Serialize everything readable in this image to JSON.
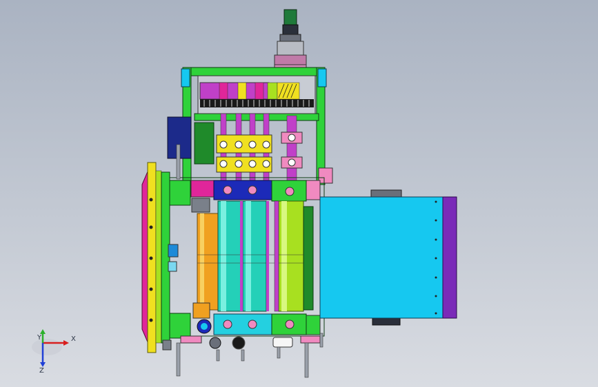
{
  "viewport": {
    "background_top": "#aab3c2",
    "background_bottom": "#d9dce2"
  },
  "triad": {
    "x_label": "X",
    "y_label": "Y",
    "z_label": "Z",
    "x_color": "#d81e1e",
    "y_color": "#2bb02b",
    "z_color": "#1f3fd6"
  },
  "model": {
    "name": "roller-assembly",
    "colors": {
      "frame_green": "#2fd23a",
      "dark_green": "#1f8a2a",
      "magenta": "#e0269a",
      "yellow": "#f0e020",
      "cyan": "#16c8f0",
      "teal": "#24d0b8",
      "lime": "#a8e020",
      "orange": "#f0a020",
      "purple": "#7a2ab8",
      "navy": "#1c2a8a",
      "pink": "#f08ac0",
      "violet": "#c060e0",
      "gray": "#7a808a",
      "black": "#1a1a1a"
    }
  }
}
